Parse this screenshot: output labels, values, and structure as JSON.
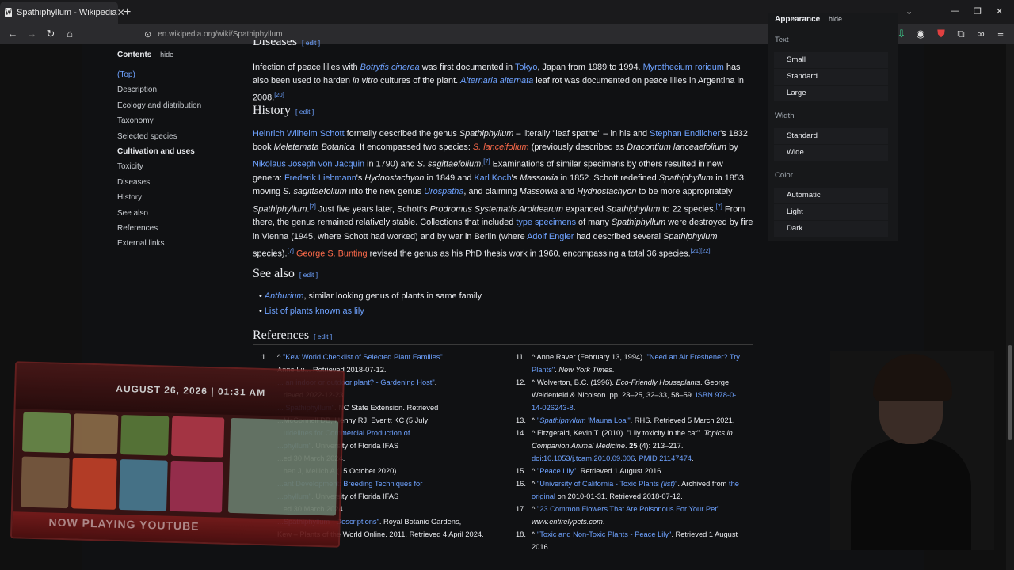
{
  "browser": {
    "tab_title": "Spathiphyllum - Wikipedia",
    "favicon": "W",
    "url": "en.wikipedia.org/wiki/Spathiphyllum"
  },
  "toc": {
    "title": "Contents",
    "hide": "hide",
    "items": [
      "(Top)",
      "Description",
      "Ecology and distribution",
      "Taxonomy",
      "Selected species",
      "Cultivation and uses",
      "Toxicity",
      "Diseases",
      "History",
      "See also",
      "References",
      "External links"
    ]
  },
  "edit": "edit",
  "diseases": {
    "heading": "Diseases"
  },
  "history": {
    "heading": "History"
  },
  "see_also": {
    "heading": "See also",
    "item1_link": "Anthurium",
    "item1_text": ", similar looking genus of plants in same family",
    "item2": "List of plants known as lily"
  },
  "references": {
    "heading": "References"
  },
  "appearance": {
    "title": "Appearance",
    "hide": "hide",
    "text_label": "Text",
    "text_opts": [
      "Small",
      "Standard",
      "Large"
    ],
    "width_label": "Width",
    "width_opts": [
      "Standard",
      "Wide"
    ],
    "color_label": "Color",
    "color_opts": [
      "Automatic",
      "Light",
      "Dark"
    ]
  },
  "overlay": {
    "date": "AUGUST 26, 2026 | 01:31 AM",
    "now_playing": "NOW PLAYING YOUTUBE"
  },
  "refs_right": [
    {
      "n": "11.",
      "html": "^ Anne Raver (February 13, 1994). <span class='c'>\"Need an Air Freshener? Try Plants\"</span>. <i>New York Times</i>."
    },
    {
      "n": "12.",
      "html": "^ Wolverton, B.C. (1996). <i>Eco-Friendly Houseplants</i>. George Weidenfeld &amp; Nicolson. pp. 23–25, 32–33, 58–59. <span class='c'>ISBN 978-0-14-026243-8</span>."
    },
    {
      "n": "13.",
      "html": "^ <span class='c'>\"<i>Spathiphyllum</i> 'Mauna Loa'\"</span>. RHS. Retrieved 5 March 2021."
    },
    {
      "n": "14.",
      "html": "^ Fitzgerald, Kevin T. (2010). \"Lily toxicity in the cat\". <i>Topics in Companion Animal Medicine</i>. <b>25</b> (4): 213–217. <span class='c'>doi:10.1053/j.tcam.2010.09.006</span>. <span class='c'>PMID 21147474</span>."
    },
    {
      "n": "15.",
      "html": "^ <span class='c'>\"Peace Lily\"</span>. Retrieved 1 August 2016."
    },
    {
      "n": "16.",
      "html": "^ <span class='c'>\"University of California - Toxic Plants <i>(list)</i>\"</span>. Archived from <span class='c'>the original</span> on 2010-01-31. Retrieved 2018-07-12."
    },
    {
      "n": "17.",
      "html": "^ <span class='c'>\"23 Common Flowers That Are Poisonous For Your Pet\"</span>. <i>www.entirelypets.com</i>."
    },
    {
      "n": "18.",
      "html": "^ <span class='c'>\"Toxic and Non-Toxic Plants - Peace Lily\"</span>. Retrieved 1 August 2016."
    }
  ],
  "refs_left": [
    {
      "n": "1.",
      "html": "^ <span class='c'>\"Kew World Checklist of Selected Plant Families\"</span>."
    },
    {
      "n": "",
      "html": "Anne Lu... Retrieved 2018-07-12."
    },
    {
      "n": "",
      "html": "<span class='c'>... an indoor or outdoor plant? - Gardening Host\"</span>."
    },
    {
      "n": "",
      "html": "...rieved 2022-12-23."
    },
    {
      "n": "",
      "html": "<span class='c'>... Spathiphyllum\"</span>. NC State Extension. Retrieved"
    },
    {
      "n": "",
      "html": "...McConnell DB, Henny RJ, Everitt KC (5 July"
    },
    {
      "n": "",
      "html": "<span class='c'>...uidelines for Commercial Production of</span>"
    },
    {
      "n": "",
      "html": "<span class='c'>...phyllum\"</span>. University of Florida IFAS"
    },
    {
      "n": "",
      "html": "...ed 30 March 2024."
    },
    {
      "n": "",
      "html": "...hen J, Mellich A (15 October 2020)."
    },
    {
      "n": "",
      "html": "<span class='c'>...ant Development: Breeding Techniques for</span>"
    },
    {
      "n": "",
      "html": "<span class='c'>...phyllum\"</span>. University of Florida IFAS"
    },
    {
      "n": "",
      "html": "...ed 30 March 2024."
    },
    {
      "n": "",
      "html": "<span class='c'>...Spathiphyllum - Descriptions\"</span>. Royal Botanic Gardens,"
    },
    {
      "n": "",
      "html": "Kew – Plants of the World Online. 2011. Retrieved 4 April 2024."
    }
  ]
}
